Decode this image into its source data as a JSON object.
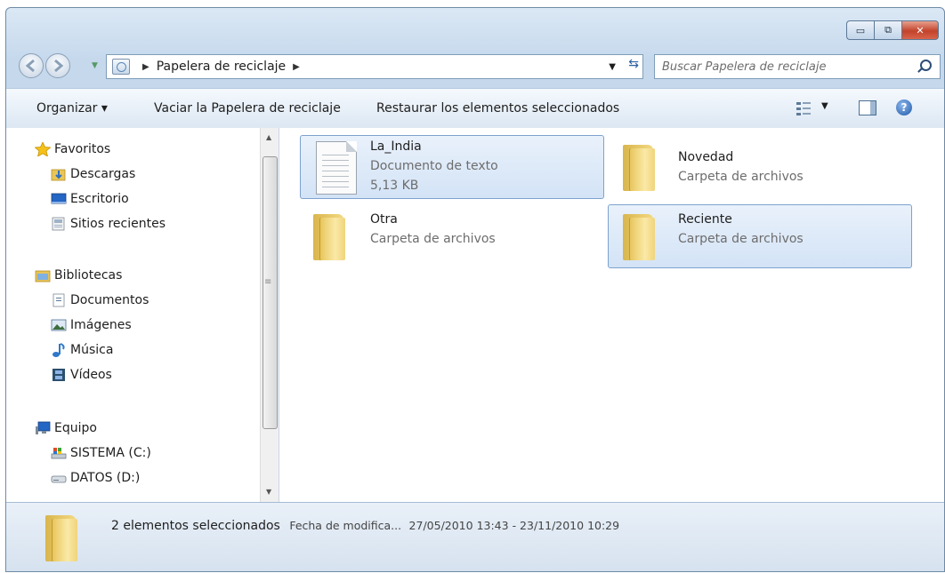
{
  "window": {
    "caption_buttons": [
      "▭",
      "⧉",
      "✕"
    ]
  },
  "address": {
    "crumbs": [
      "Papelera de reciclaje"
    ],
    "search_placeholder": "Buscar Papelera de reciclaje"
  },
  "toolbar": {
    "organize_label": "Organizar ▾",
    "empty_label": "Vaciar la Papelera de reciclaje",
    "restore_label": "Restaurar los elementos seleccionados"
  },
  "sidebar": {
    "favorites": {
      "label": "Favoritos",
      "items": [
        "Descargas",
        "Escritorio",
        "Sitios recientes"
      ]
    },
    "libraries": {
      "label": "Bibliotecas",
      "items": [
        "Documentos",
        "Imágenes",
        "Música",
        "Vídeos"
      ]
    },
    "computer": {
      "label": "Equipo",
      "items": [
        "SISTEMA (C:)",
        "DATOS (D:)"
      ]
    }
  },
  "files": [
    {
      "name": "La_India",
      "type": "Documento de texto",
      "size": "5,13 KB",
      "icon": "text-document-icon",
      "selected": true
    },
    {
      "name": "Novedad",
      "type": "Carpeta de archivos",
      "icon": "folder-icon",
      "selected": false
    },
    {
      "name": "Otra",
      "type": "Carpeta de archivos",
      "icon": "folder-icon",
      "selected": false
    },
    {
      "name": "Reciente",
      "type": "Carpeta de archivos",
      "icon": "folder-icon",
      "selected": true
    }
  ],
  "status": {
    "selection": "2 elementos seleccionados",
    "date_label": "Fecha de modifica...",
    "date_range": "27/05/2010 13:43 - 23/11/2010 10:29"
  },
  "colors": {
    "selection_border": "#7da2ce",
    "selection_fill": "#d3e3f6",
    "close_button": "#c3432b"
  }
}
